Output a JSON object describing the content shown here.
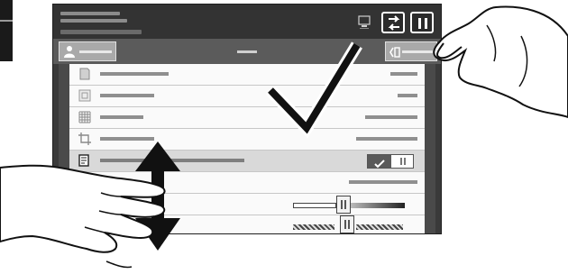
{
  "screen": {
    "topbar": {
      "device_icon": "device-status-icon",
      "swap_button_icon": "swap-arrows-icon",
      "pause_button_icon": "pause-icon"
    },
    "subbar": {
      "user_button_icon": "user-icon",
      "right_button_icon": "send-icon"
    },
    "list": {
      "rows": [
        {
          "icon": "document-icon"
        },
        {
          "icon": "page-layout-icon"
        },
        {
          "icon": "grid-icon"
        },
        {
          "icon": "crop-icon"
        },
        {
          "icon": "edit-document-icon",
          "selected": true,
          "toggle": "on"
        },
        {
          "icon": "blank-row"
        },
        {
          "icon": "slider-row"
        },
        {
          "icon": "slider-row-patterned"
        }
      ]
    }
  },
  "overlays": {
    "checkmark": "checkmark-icon",
    "scroll_arrow": "vertical-double-arrow-icon",
    "hand_right": "pointing-hand-icon",
    "hand_left": "swiping-hand-icon"
  },
  "colors": {
    "screen_bg": "#3a3a3a",
    "topbar_bg": "#333333",
    "subbar_bg": "#5b5b5b",
    "row_bg": "#fafafa",
    "row_selected_bg": "#d9d9d9"
  }
}
